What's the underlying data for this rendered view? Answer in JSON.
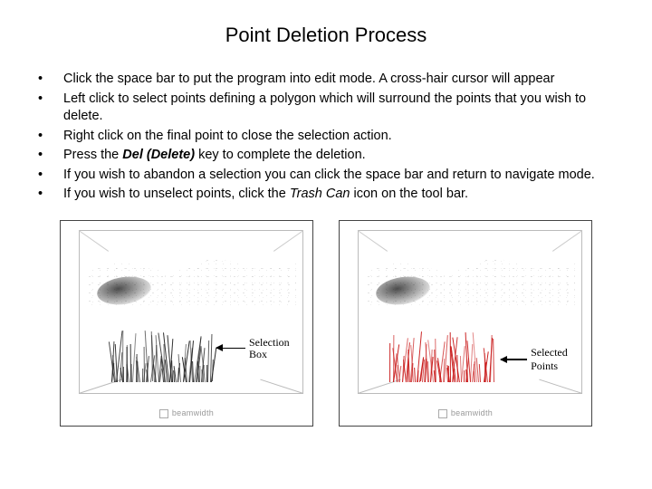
{
  "title": "Point Deletion Process",
  "bullets": [
    {
      "text": "Click the space bar to put the program into edit mode.  A cross-hair cursor will appear"
    },
    {
      "text": "Left click to select points defining a polygon which will surround the points that you wish to delete."
    },
    {
      "text": "Right click on the final point to close the selection action."
    },
    {
      "prefix": "Press the ",
      "emph": "Del (Delete)",
      "suffix": " key to complete the deletion."
    },
    {
      "text": "If you wish to abandon a selection you can click the space bar and return to navigate mode."
    },
    {
      "prefix": "If you wish to unselect points, click the ",
      "ital": "Trash Can",
      "suffix": " icon on the tool bar."
    }
  ],
  "figures": {
    "left": {
      "annotation": "Selection",
      "annotation2": "Box",
      "axis": "beamwidth",
      "cluster_color": "black"
    },
    "right": {
      "annotation": "Selected Points",
      "axis": "beamwidth",
      "cluster_color": "red"
    }
  }
}
